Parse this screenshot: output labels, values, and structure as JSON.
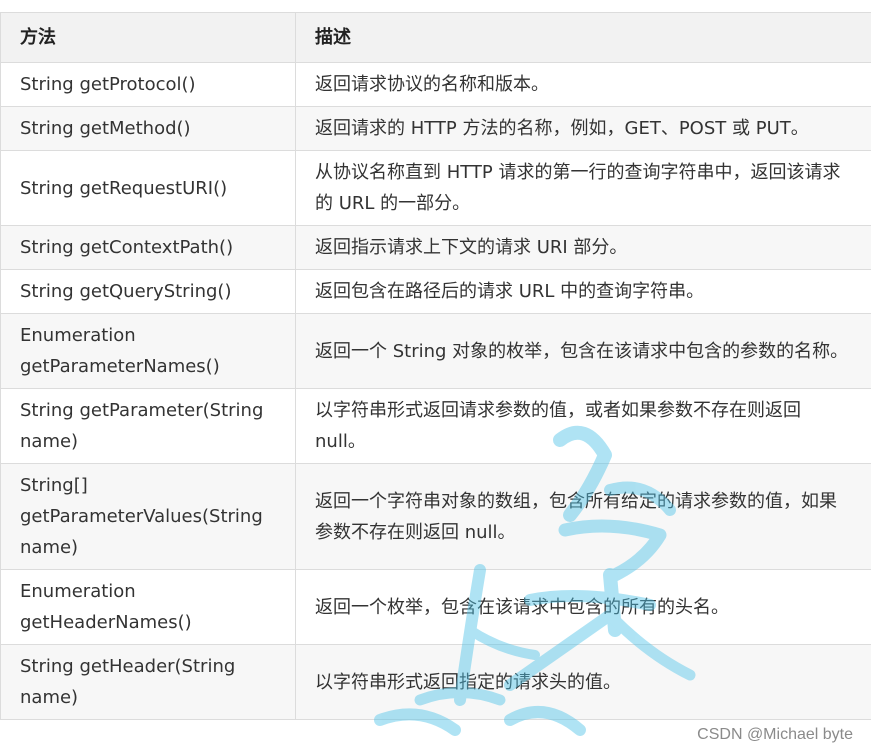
{
  "table": {
    "headers": {
      "method": "方法",
      "description": "描述"
    },
    "rows": [
      {
        "method": "String getProtocol()",
        "description": "返回请求协议的名称和版本。"
      },
      {
        "method": "String getMethod()",
        "description": "返回请求的 HTTP 方法的名称，例如，GET、POST 或 PUT。"
      },
      {
        "method": "String getRequestURI()",
        "description": "从协议名称直到 HTTP 请求的第一行的查询字符串中，返回该请求的 URL 的一部分。"
      },
      {
        "method": "String getContextPath()",
        "description": "返回指示请求上下文的请求 URI 部分。"
      },
      {
        "method": "String getQueryString()",
        "description": "返回包含在路径后的请求 URL 中的查询字符串。"
      },
      {
        "method": "Enumeration getParameterNames()",
        "description": "返回一个 String 对象的枚举，包含在该请求中包含的参数的名称。"
      },
      {
        "method": "String getParameter(String name)",
        "description": "以字符串形式返回请求参数的值，或者如果参数不存在则返回 null。"
      },
      {
        "method": "String[] getParameterValues(String name)",
        "description": "返回一个字符串对象的数组，包含所有给定的请求参数的值，如果参数不存在则返回 null。"
      },
      {
        "method": "Enumeration getHeaderNames()",
        "description": "返回一个枚举，包含在该请求中包含的所有的头名。"
      },
      {
        "method": "String getHeader(String name)",
        "description": "以字符串形式返回指定的请求头的值。"
      }
    ]
  },
  "watermark_text": "CSDN @Michael byte",
  "colors": {
    "header_bg": "#f2f2f2",
    "alt_row_bg": "#f7f7f7",
    "border": "#dcdcdc",
    "text": "#333333",
    "watermark_blue": "#4fc3e8"
  }
}
